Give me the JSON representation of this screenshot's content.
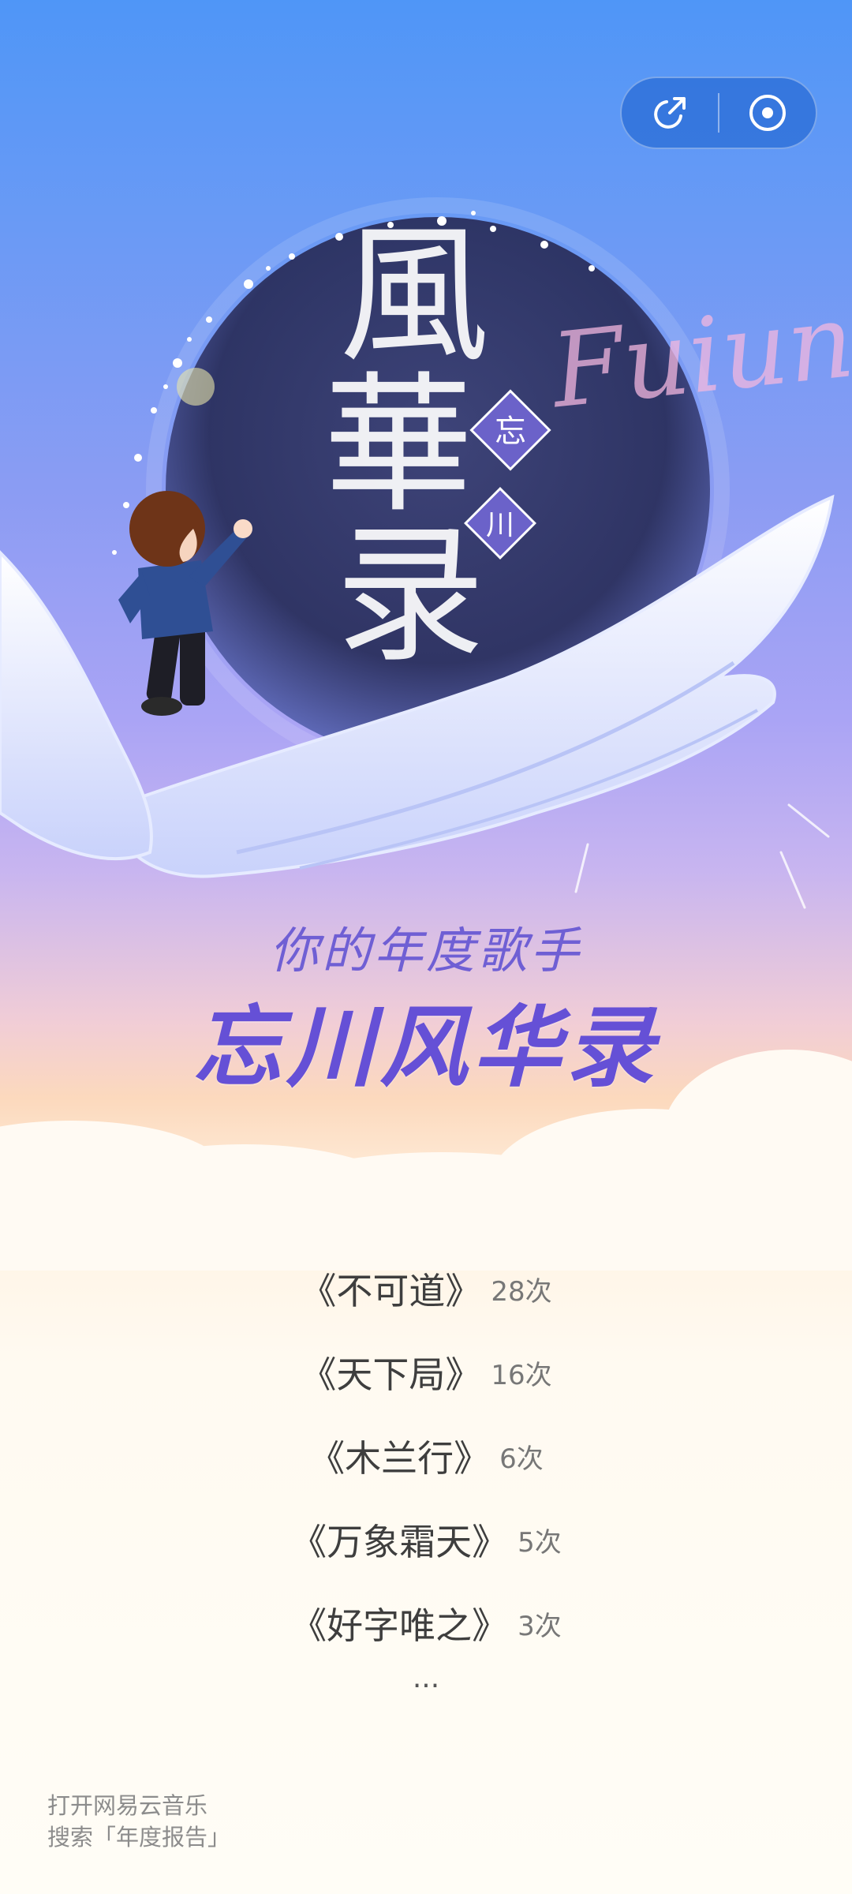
{
  "hero": {
    "calligraphy": [
      "風",
      "華",
      "录"
    ],
    "seal_chars": [
      "忘",
      "川"
    ],
    "script_word": "Fuiun"
  },
  "title": {
    "subtitle": "你的年度歌手",
    "singer": "忘川风华录"
  },
  "songs": [
    {
      "title": "《不可道》",
      "count": "28次"
    },
    {
      "title": "《天下局》",
      "count": "16次"
    },
    {
      "title": "《木兰行》",
      "count": "6次"
    },
    {
      "title": "《万象霜天》",
      "count": "5次"
    },
    {
      "title": "《好字唯之》",
      "count": "3次"
    }
  ],
  "more": "...",
  "footer": {
    "line1": "打开网易云音乐",
    "line2": "搜索「年度报告」"
  },
  "icons": {
    "share": "share-icon",
    "close": "close-circle-icon"
  },
  "colors": {
    "accent": "#6550d6",
    "capsule": "#2c6ed7"
  }
}
